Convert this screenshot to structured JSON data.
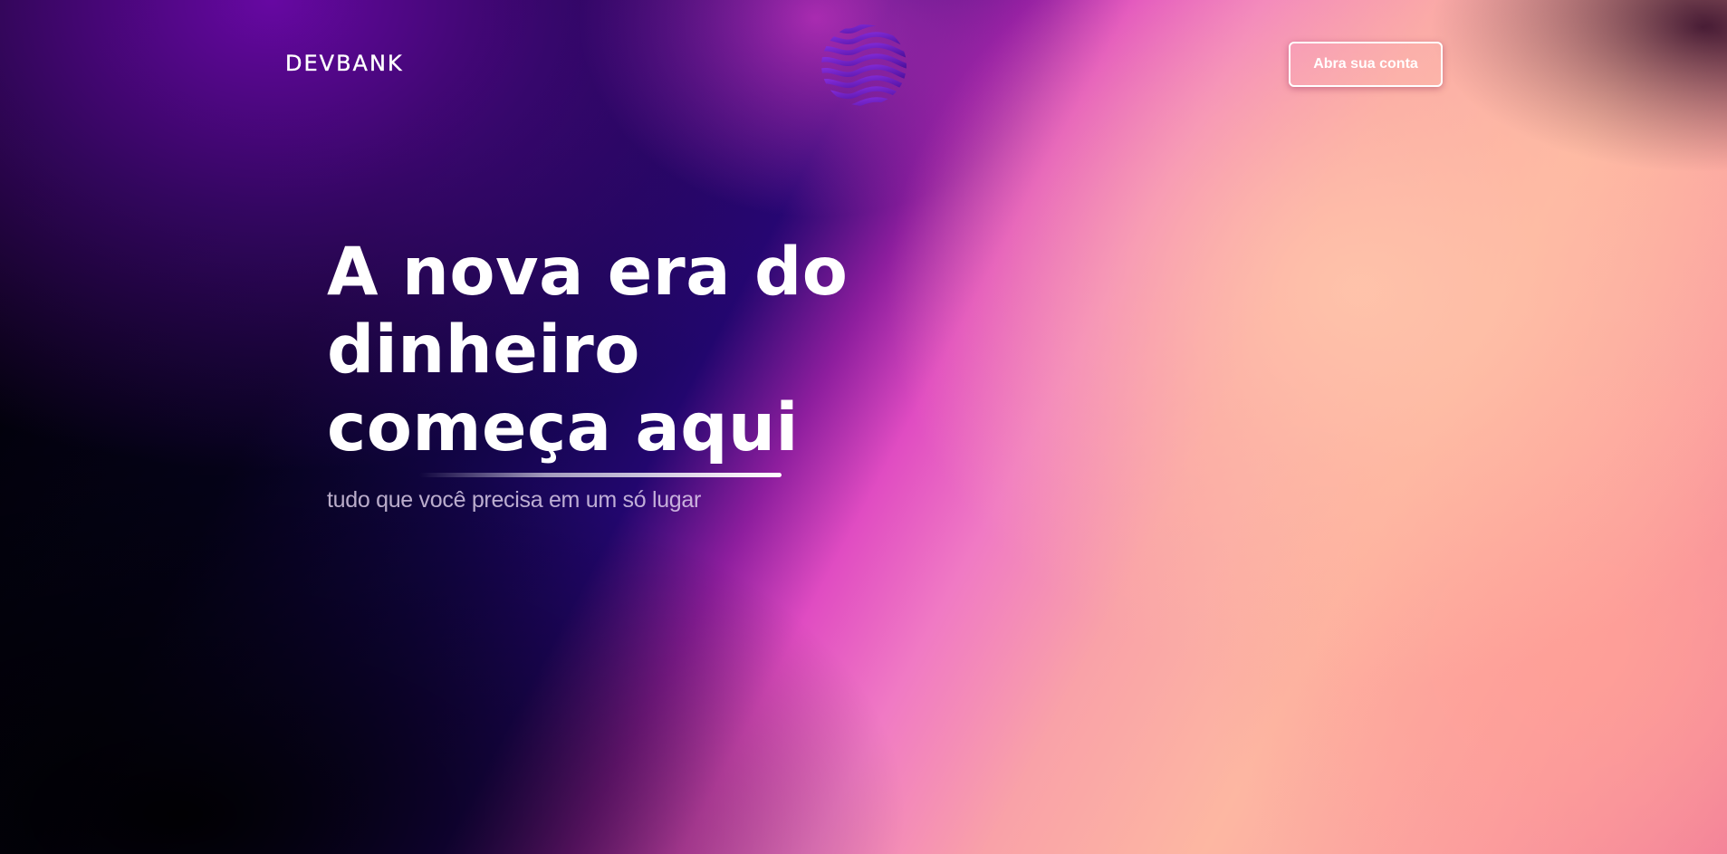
{
  "header": {
    "logo_text": "DEVBANK",
    "cta_label": "Abra sua conta"
  },
  "hero": {
    "title_line1": "A nova era do dinheiro",
    "title_line2": "começa aqui",
    "subtitle": "tudo que você precisa em um só lugar"
  },
  "colors": {
    "accent_purple": "#5b0fa6",
    "accent_pink": "#e04cc2",
    "accent_peach": "#fdb7a2",
    "text": "#ffffff"
  },
  "icons": {
    "logo_mark": "wave-globe-icon"
  }
}
